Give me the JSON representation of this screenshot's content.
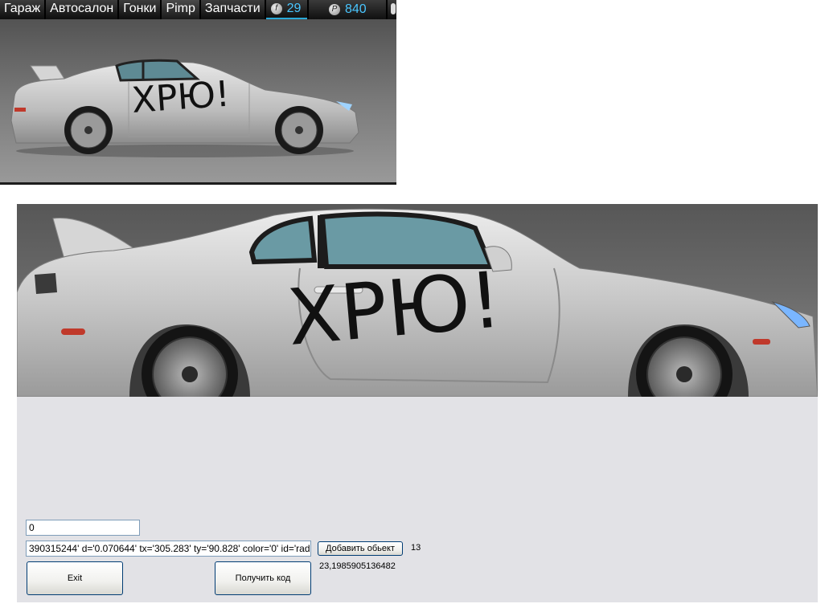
{
  "menu": {
    "items": [
      "Гараж",
      "Автосалон",
      "Гонки",
      "Pimp",
      "Запчасти"
    ],
    "currency1_icon": "f-coin-icon",
    "currency1": "29",
    "currency2_icon": "p-coin-icon",
    "currency2": "840"
  },
  "car": {
    "graffiti": "ХРЮ!",
    "body_color": "#c4c4c4"
  },
  "form": {
    "number_value": "0",
    "xml_value": "390315244' d='0.070644' tx='305.283' ty='90.828' color='0' id='radiation'/>",
    "add_button": "Добавить обьект",
    "count": "13",
    "exit_button": "Exit",
    "get_code_button": "Получить код",
    "coords": "23,1985905136482"
  }
}
